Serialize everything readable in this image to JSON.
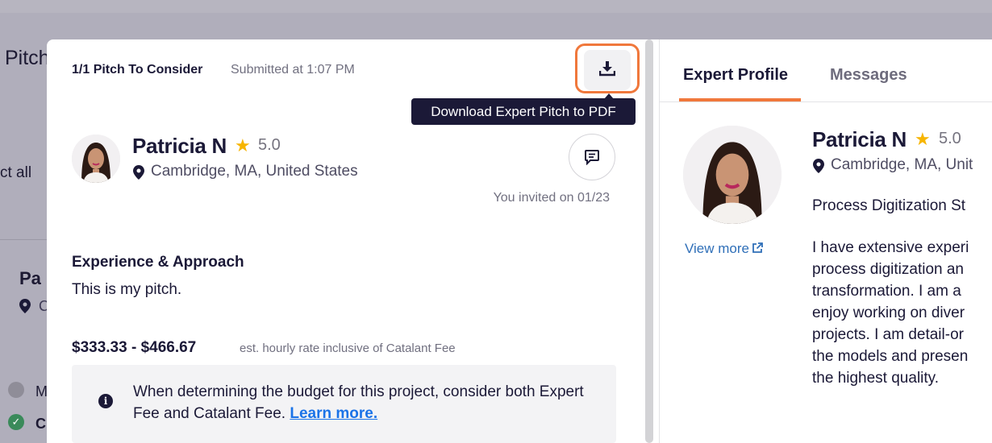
{
  "background": {
    "page_title_fragment": "Pitch",
    "select_all_fragment": "ct all",
    "card_name_fragment": "Pa",
    "card_location_fragment": "C",
    "status1_fragment": "M",
    "status2_fragment": "C"
  },
  "pitch": {
    "count_label": "1/1 Pitch To Consider",
    "submitted_label": "Submitted at 1:07 PM",
    "download_tooltip": "Download Expert Pitch to PDF",
    "expert": {
      "name": "Patricia N",
      "rating": "5.0",
      "location": "Cambridge, MA, United States"
    },
    "invited_label": "You invited on 01/23",
    "experience_heading": "Experience & Approach",
    "experience_text": "This is my pitch.",
    "rate_range": "$333.33 - $466.67",
    "rate_note": "est. hourly rate inclusive of Catalant Fee",
    "info_text": "When determining the budget for this project, consider both Expert Fee and Catalant Fee.",
    "info_link": "Learn more."
  },
  "profile": {
    "tabs": [
      "Expert Profile",
      "Messages"
    ],
    "name": "Patricia N",
    "rating": "5.0",
    "location": "Cambridge, MA, Unit",
    "title": "Process Digitization St",
    "view_more": "View more",
    "bio_lines": [
      "I have extensive experi",
      "process digitization an",
      "transformation. I am a",
      "enjoy working on diver",
      "projects. I am detail-or",
      "the models and presen",
      "the highest quality."
    ]
  },
  "colors": {
    "accent": "#f0783c",
    "navy": "#1b1937",
    "star": "#f7b500",
    "link": "#1a73e8"
  },
  "icons": [
    "download-icon",
    "star-icon",
    "location-pin-icon",
    "message-icon",
    "info-icon",
    "external-link-icon"
  ]
}
